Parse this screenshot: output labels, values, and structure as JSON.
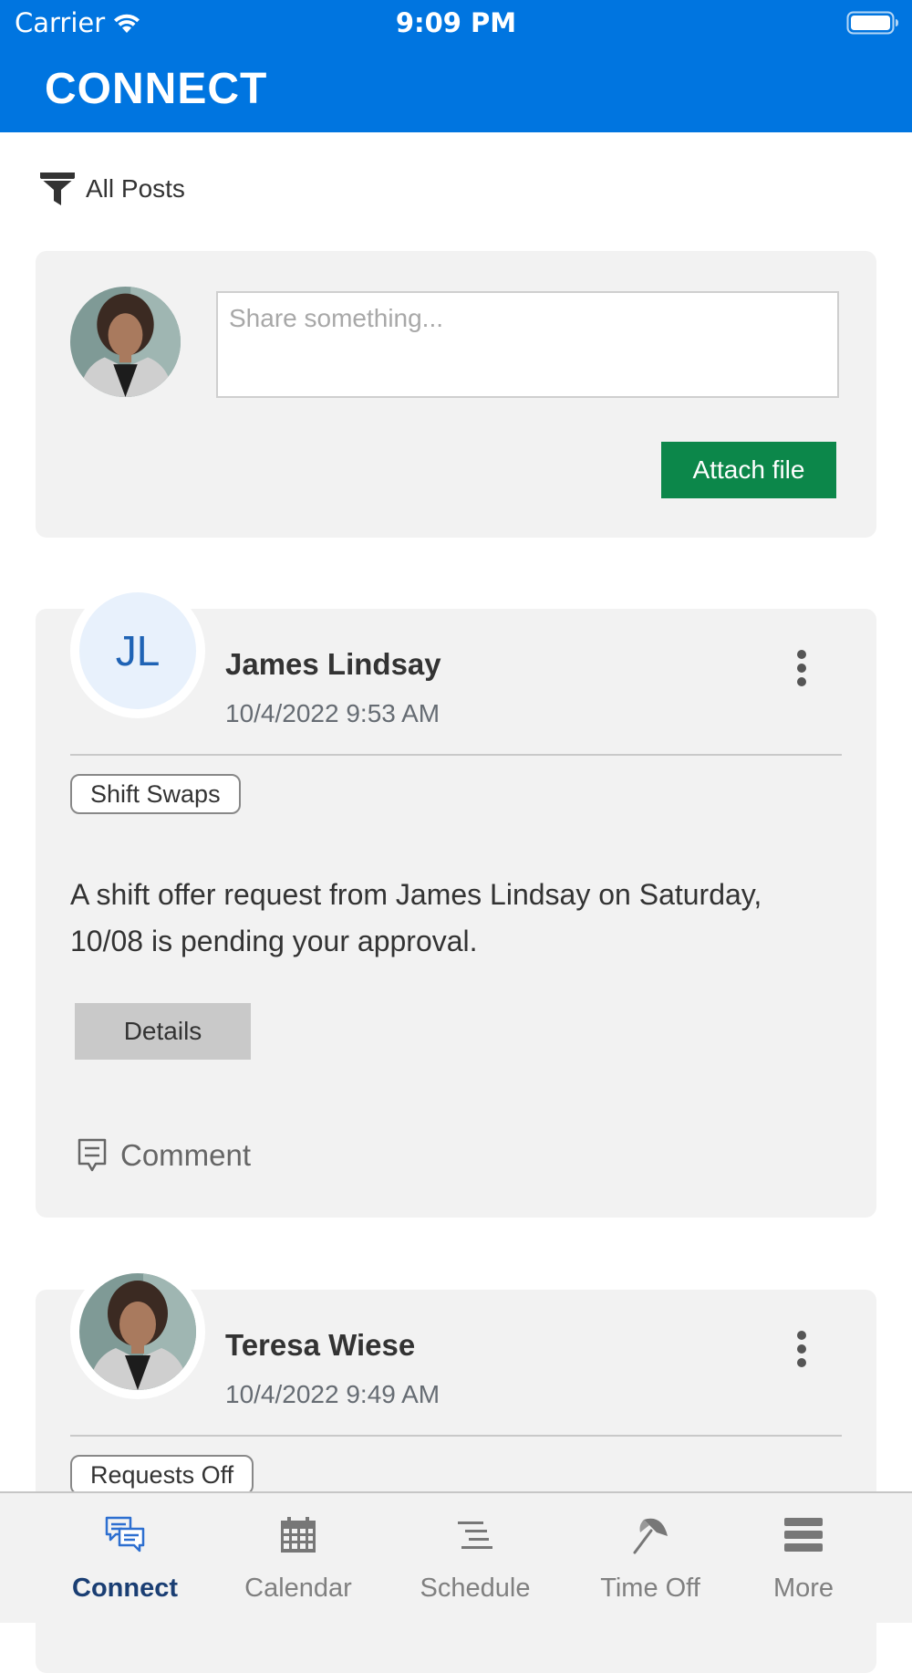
{
  "status_bar": {
    "carrier": "Carrier",
    "time": "9:09 PM"
  },
  "header": {
    "title": "CONNECT"
  },
  "filter": {
    "label": "All Posts"
  },
  "compose": {
    "placeholder": "Share something...",
    "attach_label": "Attach file"
  },
  "posts": [
    {
      "initials": "JL",
      "author": "James Lindsay",
      "timestamp": "10/4/2022 9:53 AM",
      "tag": "Shift Swaps",
      "body": "A shift offer request from James Lindsay on Saturday, 10/08 is pending your approval.",
      "details_label": "Details",
      "comment_label": "Comment"
    },
    {
      "author": "Teresa Wiese",
      "timestamp": "10/4/2022 9:49 AM",
      "tag": "Requests Off"
    }
  ],
  "tabs": [
    {
      "label": "Connect",
      "icon": "chat-bubbles-icon",
      "active": true
    },
    {
      "label": "Calendar",
      "icon": "calendar-icon"
    },
    {
      "label": "Schedule",
      "icon": "schedule-lines-icon"
    },
    {
      "label": "Time Off",
      "icon": "umbrella-icon"
    },
    {
      "label": "More",
      "icon": "menu-icon"
    }
  ],
  "colors": {
    "header_bg": "#0075e0",
    "attach_button": "#0c874a",
    "active_tab": "#1a3e73",
    "card_bg": "#f2f2f2"
  }
}
